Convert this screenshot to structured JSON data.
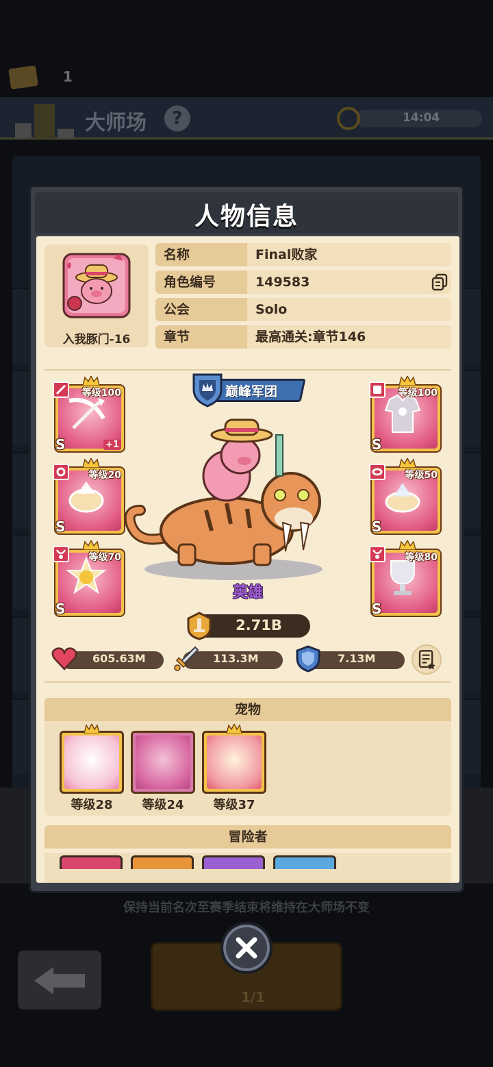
{
  "background": {
    "ticket_count": "1",
    "arena_title": "大师场",
    "help_symbol": "?",
    "timer": "14:04",
    "notice": "保持当前名次至赛季结束将维持在大师场不变",
    "challenge_count": "1/1"
  },
  "modal": {
    "title": "人物信息",
    "avatar_name": "入我豚门-16",
    "info": [
      {
        "label": "名称",
        "value": "Final败家"
      },
      {
        "label": "角色编号",
        "value": "149583"
      },
      {
        "label": "公会",
        "value": "Solo"
      },
      {
        "label": "章节",
        "value": "最高通关:章节146"
      }
    ],
    "guild_rank": "巅峰军团",
    "hero_label": "英雄",
    "power": "2.71B",
    "stats": {
      "hp": "605.63M",
      "attack": "113.3M",
      "defense": "7.13M"
    },
    "equipment_left": [
      {
        "slot": "weapon",
        "level": "等级100",
        "rank": "S",
        "bonus": "+1"
      },
      {
        "slot": "ring",
        "level": "等级20",
        "rank": "S"
      },
      {
        "slot": "necklace",
        "level": "等级70",
        "rank": "S"
      }
    ],
    "equipment_right": [
      {
        "slot": "armor",
        "level": "等级100",
        "rank": "S"
      },
      {
        "slot": "bracelet",
        "level": "等级50",
        "rank": "S"
      },
      {
        "slot": "amulet",
        "level": "等级80",
        "rank": "S"
      }
    ],
    "pets_title": "宠物",
    "pets": [
      {
        "level": "等级28"
      },
      {
        "level": "等级24"
      },
      {
        "level": "等级37"
      }
    ],
    "adventurers_title": "冒险者"
  },
  "colors": {
    "panel_bg": "#f7ebd2",
    "label_bg": "#e6ca97",
    "equip_frame": "#f2c24a",
    "equip_inner": "#e25d85",
    "guild_blue": "#3e6fb0",
    "hero_purple": "#a05fd0"
  },
  "icons": [
    "copy-icon",
    "heart-icon",
    "sword-icon",
    "shield-icon",
    "stats-list-icon",
    "close-icon",
    "power-icon"
  ]
}
